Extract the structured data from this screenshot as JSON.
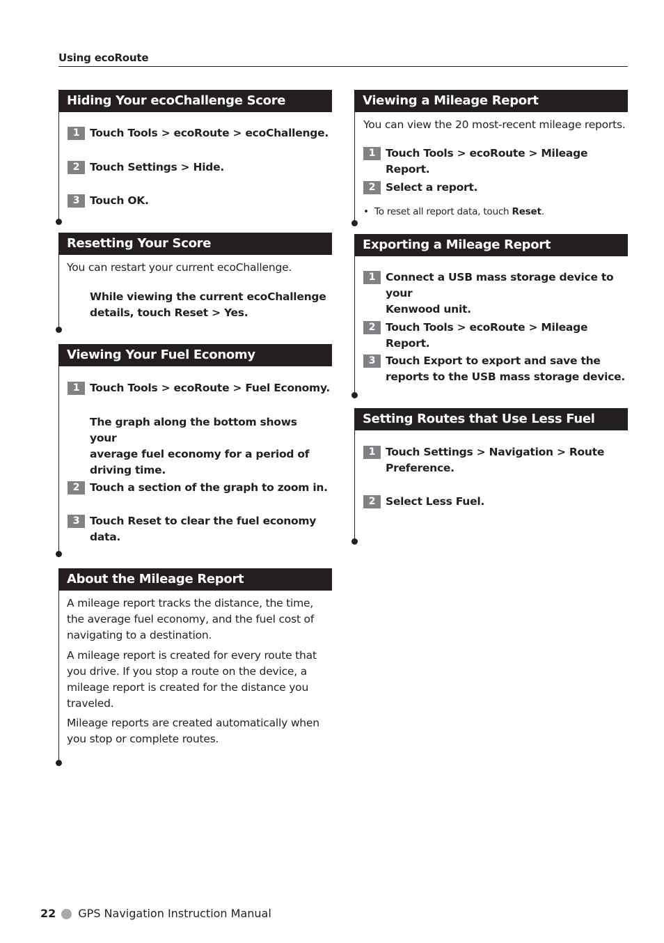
{
  "running_head": "Using ecoRoute",
  "left_column": {
    "hiding": {
      "title": "Hiding Your ecoChallenge Score",
      "steps": [
        {
          "num": "1",
          "text": "Touch Tools > ecoRoute > ecoChallenge."
        },
        {
          "num": "2",
          "text": "Touch Settings > Hide."
        },
        {
          "num": "3",
          "text": "Touch OK."
        }
      ]
    },
    "resetting": {
      "title": "Resetting Your Score",
      "intro": "You can restart your current ecoChallenge.",
      "instruction_line1": "While viewing the current ecoChallenge",
      "instruction_line2": "details, touch Reset > Yes."
    },
    "fuel_economy": {
      "title": "Viewing Your Fuel Economy",
      "steps": [
        {
          "num": "1",
          "text": "Touch Tools > ecoRoute > Fuel Economy."
        },
        {
          "num": "2",
          "text": "Touch a section of the graph to zoom in."
        },
        {
          "num": "3",
          "text_line1": "Touch Reset to clear the fuel economy",
          "text_line2": "data."
        }
      ],
      "note_line1": "The graph along the bottom shows your",
      "note_line2": "average fuel economy for a period of",
      "note_line3": "driving time."
    },
    "about_mileage": {
      "title": "About the Mileage Report",
      "p1": [
        "A mileage report tracks the distance, the time,",
        "the average fuel economy, and the fuel cost of",
        "navigating to a destination."
      ],
      "p2": [
        "A mileage report is created for every route that",
        "you drive. If you stop a route on the device, a",
        "mileage report is created for the distance you",
        "traveled."
      ],
      "p3": [
        "Mileage reports are created automatically when",
        "you stop or complete routes."
      ]
    }
  },
  "right_column": {
    "viewing_mileage": {
      "title": "Viewing a Mileage Report",
      "intro": "You can view the 20 most-recent mileage reports.",
      "steps": [
        {
          "num": "1",
          "text": "Touch Tools > ecoRoute > Mileage Report."
        },
        {
          "num": "2",
          "text": "Select a report."
        }
      ],
      "bullet_prefix": "To reset all report data, touch ",
      "bullet_bold": "Reset",
      "bullet_suffix": "."
    },
    "exporting": {
      "title": "Exporting a Mileage Report",
      "steps": [
        {
          "num": "1",
          "text_line1": "Connect a USB mass storage device to your",
          "text_line2": "Kenwood unit."
        },
        {
          "num": "2",
          "text": "Touch Tools > ecoRoute > Mileage Report."
        },
        {
          "num": "3",
          "text_line1": "Touch Export to export and save the",
          "text_line2": "reports to the USB mass storage device."
        }
      ]
    },
    "less_fuel": {
      "title": "Setting Routes that Use Less Fuel",
      "steps": [
        {
          "num": "1",
          "text_line1": "Touch Settings > Navigation > Route",
          "text_line2": "Preference."
        },
        {
          "num": "2",
          "text": "Select Less Fuel."
        }
      ]
    }
  },
  "footer": {
    "page_number": "22",
    "manual_title": "GPS Navigation Instruction Manual"
  }
}
